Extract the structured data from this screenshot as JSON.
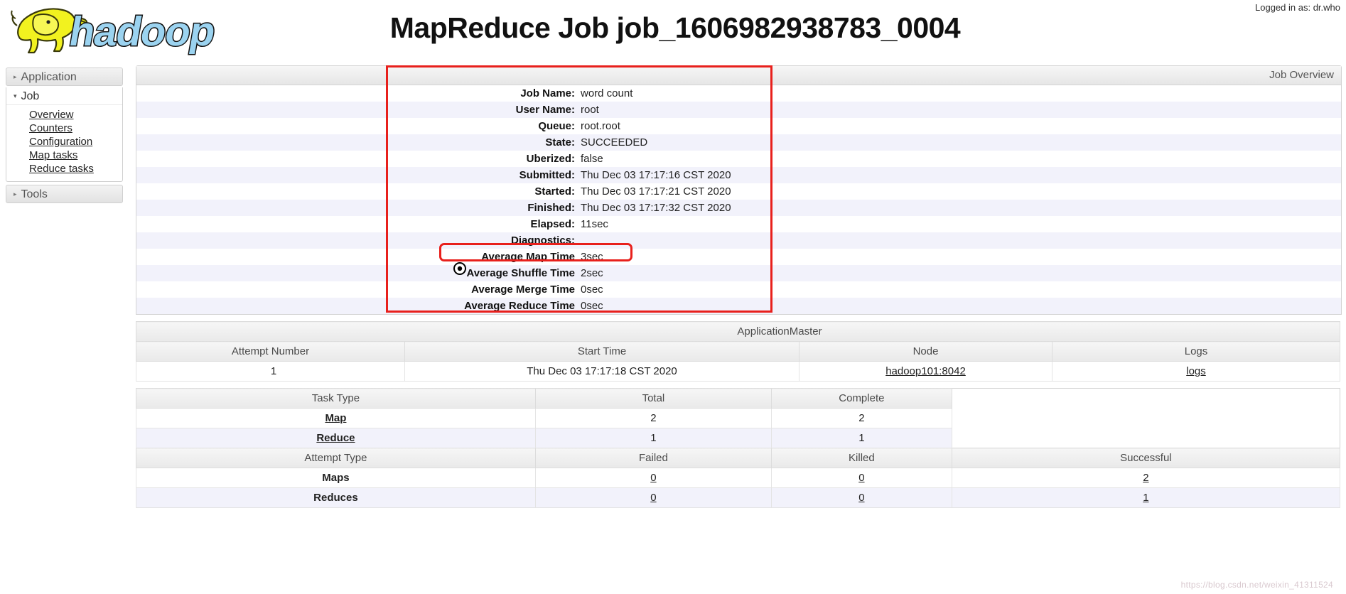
{
  "header": {
    "logo_alt": "hadoop",
    "logo_text": "hadoop",
    "title": "MapReduce Job job_1606982938783_0004",
    "login_label": "Logged in as: dr.who"
  },
  "sidebar": {
    "sections": [
      {
        "label": "Application",
        "expanded": false,
        "arrow": "▸"
      },
      {
        "label": "Job",
        "expanded": true,
        "arrow": "▾"
      },
      {
        "label": "Tools",
        "expanded": false,
        "arrow": "▸"
      }
    ],
    "job_links": [
      {
        "label": "Overview"
      },
      {
        "label": "Counters"
      },
      {
        "label": "Configuration"
      },
      {
        "label": "Map tasks"
      },
      {
        "label": "Reduce tasks"
      }
    ]
  },
  "overview": {
    "panel_title": "Job Overview",
    "rows": [
      {
        "label": "Job Name:",
        "value": "word count"
      },
      {
        "label": "User Name:",
        "value": "root"
      },
      {
        "label": "Queue:",
        "value": "root.root"
      },
      {
        "label": "State:",
        "value": "SUCCEEDED"
      },
      {
        "label": "Uberized:",
        "value": "false"
      },
      {
        "label": "Submitted:",
        "value": "Thu Dec 03 17:17:16 CST 2020"
      },
      {
        "label": "Started:",
        "value": "Thu Dec 03 17:17:21 CST 2020"
      },
      {
        "label": "Finished:",
        "value": "Thu Dec 03 17:17:32 CST 2020"
      },
      {
        "label": "Elapsed:",
        "value": "11sec"
      },
      {
        "label": "Diagnostics:",
        "value": ""
      },
      {
        "label": "Average Map Time",
        "value": "3sec"
      },
      {
        "label": "Average Shuffle Time",
        "value": "2sec"
      },
      {
        "label": "Average Merge Time",
        "value": "0sec"
      },
      {
        "label": "Average Reduce Time",
        "value": "0sec"
      }
    ]
  },
  "application_master": {
    "title": "ApplicationMaster",
    "columns": [
      "Attempt Number",
      "Start Time",
      "Node",
      "Logs"
    ],
    "rows": [
      {
        "attempt_number": "1",
        "start_time": "Thu Dec 03 17:17:18 CST 2020",
        "node": "hadoop101:8042",
        "logs": "logs"
      }
    ]
  },
  "task_summary": {
    "columns": [
      "Task Type",
      "Total",
      "Complete"
    ],
    "rows": [
      {
        "task_type": "Map",
        "total": "2",
        "complete": "2"
      },
      {
        "task_type": "Reduce",
        "total": "1",
        "complete": "1"
      }
    ]
  },
  "attempt_summary": {
    "columns": [
      "Attempt Type",
      "Failed",
      "Killed",
      "Successful"
    ],
    "rows": [
      {
        "attempt_type": "Maps",
        "failed": "0",
        "killed": "0",
        "successful": "2"
      },
      {
        "attempt_type": "Reduces",
        "failed": "0",
        "killed": "0",
        "successful": "1"
      }
    ]
  },
  "annotations": {
    "color": "#e8201c",
    "main_box_label": "job-overview-highlight",
    "map_time_box_label": "average-map-time-highlight"
  },
  "watermark": {
    "text": "https://blog.csdn.net/weixin_41311524"
  }
}
